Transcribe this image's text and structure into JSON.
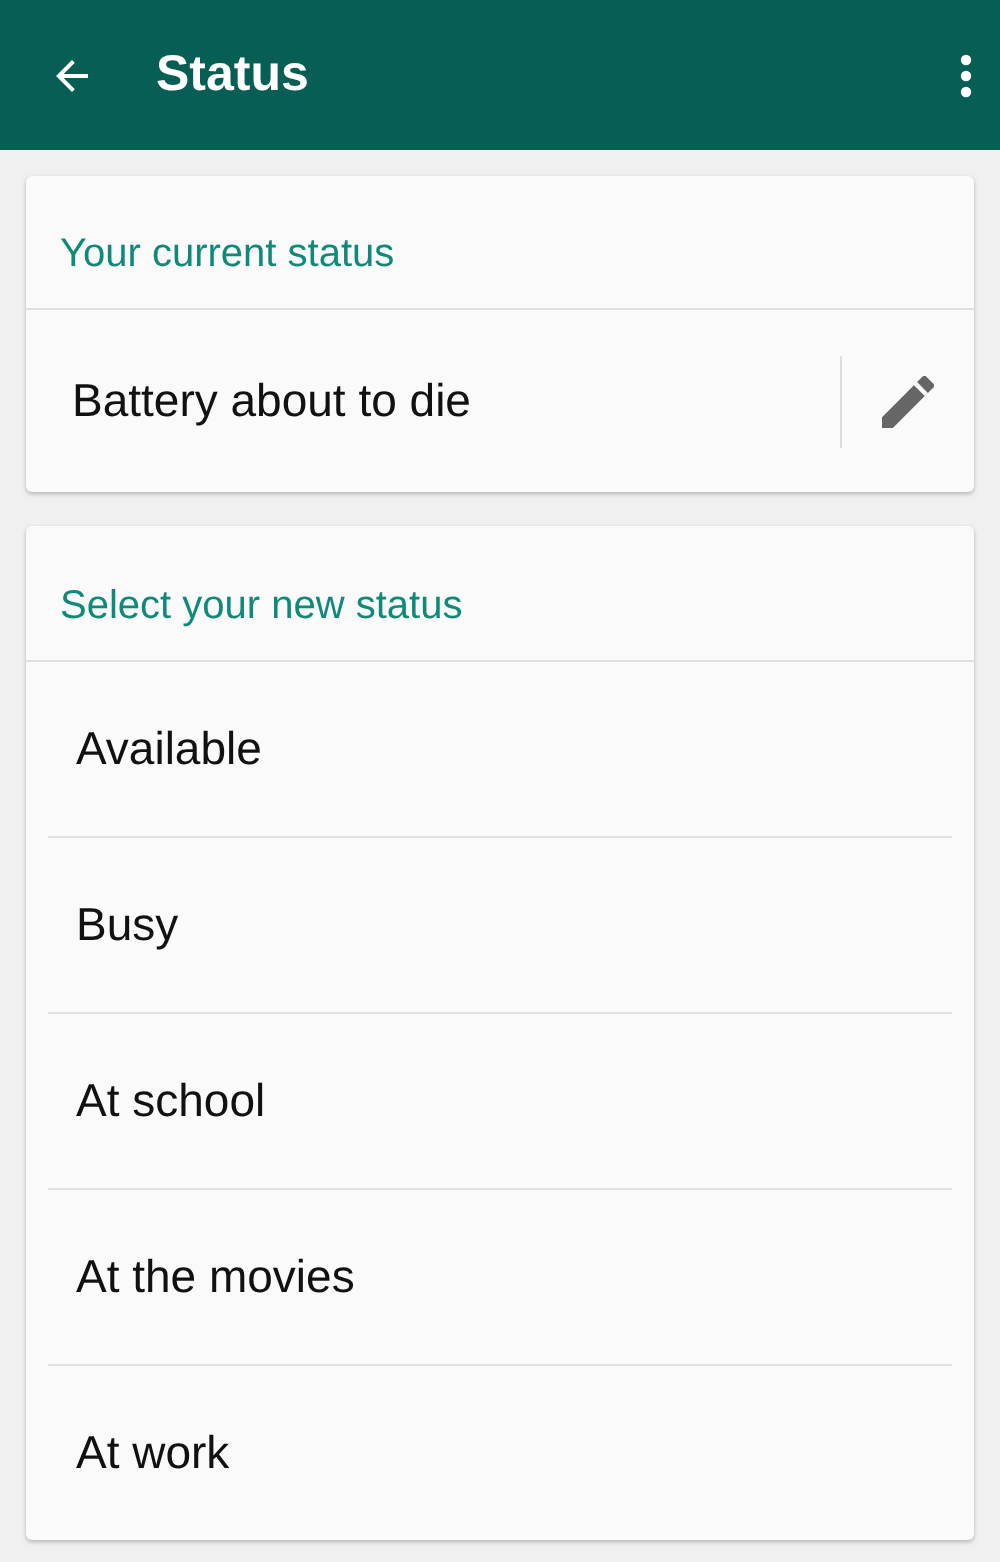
{
  "app_bar": {
    "title": "Status"
  },
  "current": {
    "header": "Your current status",
    "status": "Battery about to die"
  },
  "choices": {
    "header": "Select your new status",
    "items": [
      {
        "label": "Available"
      },
      {
        "label": "Busy"
      },
      {
        "label": "At school"
      },
      {
        "label": "At the movies"
      },
      {
        "label": "At work"
      }
    ]
  }
}
